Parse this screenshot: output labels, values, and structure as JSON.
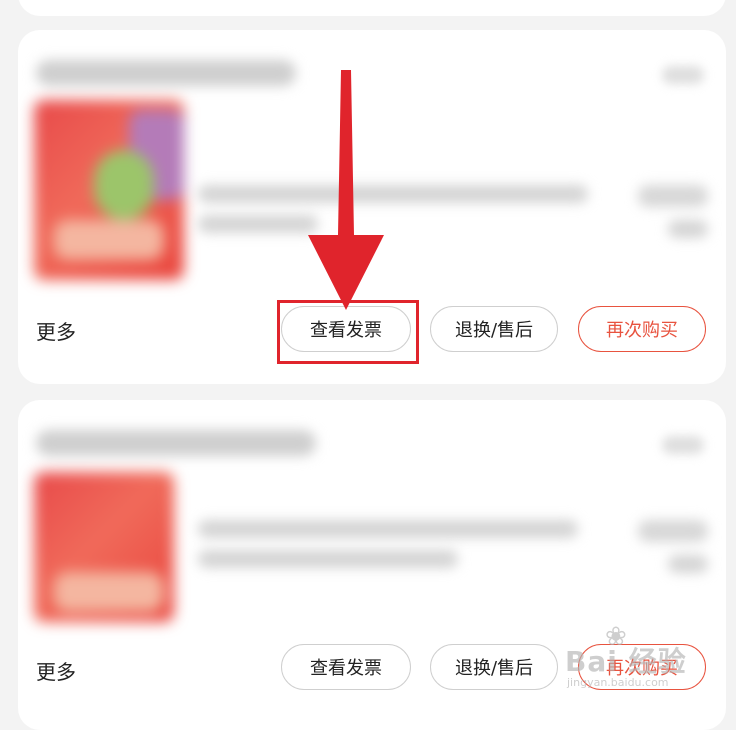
{
  "orders": [
    {
      "more_label": "更多",
      "buttons": {
        "invoice": "查看发票",
        "return_service": "退换/售后",
        "buy_again": "再次购买"
      }
    },
    {
      "more_label": "更多",
      "buttons": {
        "invoice": "查看发票",
        "return_service": "退换/售后",
        "buy_again": "再次购买"
      }
    }
  ],
  "annotation": {
    "highlight_color": "#e0242c",
    "target": "查看发票"
  },
  "watermark": {
    "brand": "Bai 经验",
    "url": "jingyan.baidu.com"
  },
  "colors": {
    "accent_red": "#e8533f",
    "background": "#f3f3f3",
    "card": "#ffffff"
  }
}
